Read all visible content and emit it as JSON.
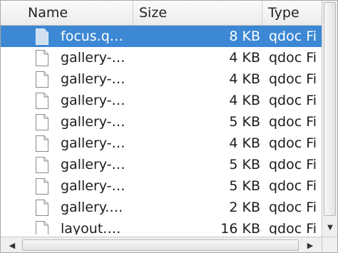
{
  "columns": {
    "name": "Name",
    "size": "Size",
    "type": "Type"
  },
  "rows": [
    {
      "name": "focus.q…",
      "size": "8 KB",
      "type": "qdoc Fi",
      "selected": true
    },
    {
      "name": "gallery-…",
      "size": "4 KB",
      "type": "qdoc Fi",
      "selected": false
    },
    {
      "name": "gallery-…",
      "size": "4 KB",
      "type": "qdoc Fi",
      "selected": false
    },
    {
      "name": "gallery-…",
      "size": "4 KB",
      "type": "qdoc Fi",
      "selected": false
    },
    {
      "name": "gallery-…",
      "size": "5 KB",
      "type": "qdoc Fi",
      "selected": false
    },
    {
      "name": "gallery-…",
      "size": "4 KB",
      "type": "qdoc Fi",
      "selected": false
    },
    {
      "name": "gallery-…",
      "size": "5 KB",
      "type": "qdoc Fi",
      "selected": false
    },
    {
      "name": "gallery-…",
      "size": "5 KB",
      "type": "qdoc Fi",
      "selected": false
    },
    {
      "name": "gallery.…",
      "size": "2 KB",
      "type": "qdoc Fi",
      "selected": false
    },
    {
      "name": "layout.…",
      "size": "16 KB",
      "type": "qdoc Fi",
      "selected": false
    }
  ],
  "icons": {
    "file": "file-icon",
    "scroll_left": "arrow-left-icon",
    "scroll_right": "arrow-right-icon",
    "scroll_down": "arrow-down-icon"
  },
  "colors": {
    "selection": "#3c88d4"
  }
}
